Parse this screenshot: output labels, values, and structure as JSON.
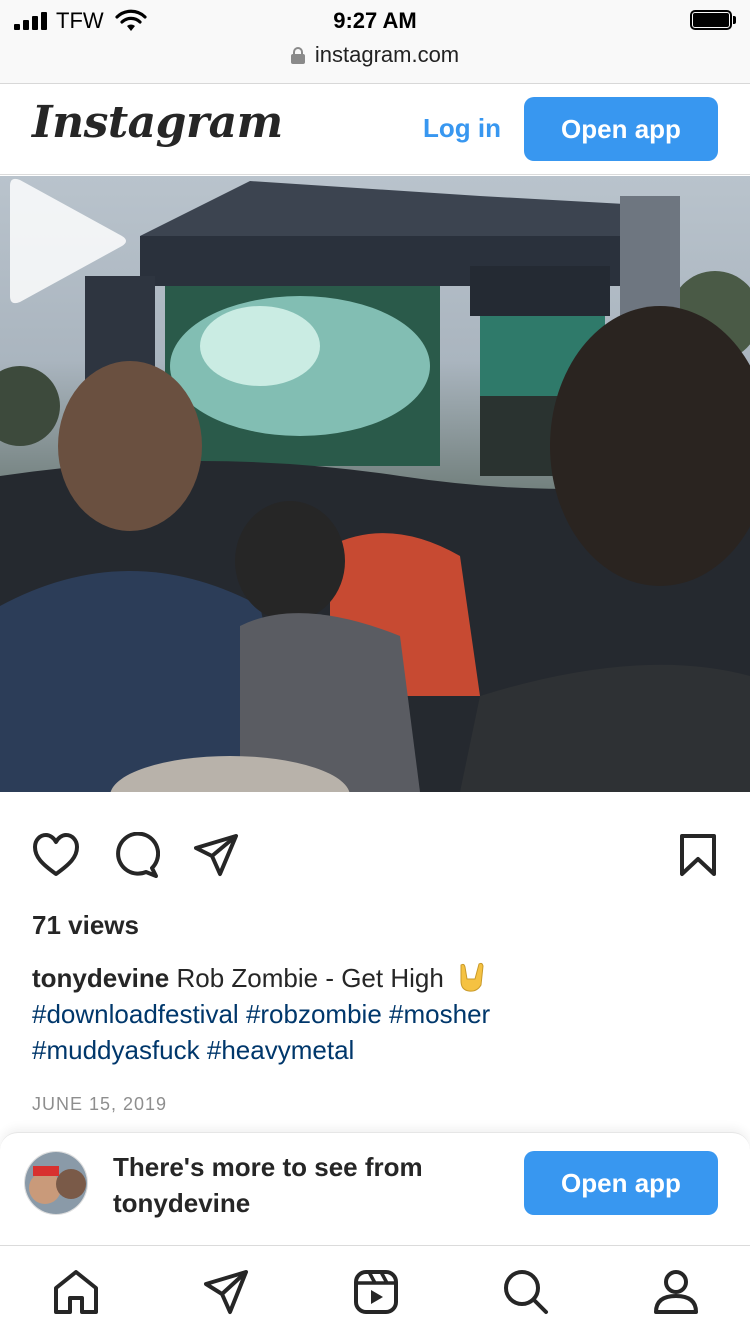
{
  "status_bar": {
    "carrier": "TFW",
    "time": "9:27 AM",
    "icons": [
      "signal-icon",
      "wifi-icon",
      "battery-icon"
    ]
  },
  "url_bar": {
    "domain": "instagram.com",
    "icon": "lock-icon"
  },
  "header": {
    "logo": "Instagram",
    "login_label": "Log in",
    "open_app_label": "Open app"
  },
  "video": {
    "description_icon": "play-icon"
  },
  "actions": {
    "icons": [
      "heart-icon",
      "comment-icon",
      "share-icon",
      "bookmark-icon"
    ]
  },
  "post": {
    "views": "71 views",
    "username": "tonydevine",
    "caption_text": "Rob Zombie - Get High",
    "hashtags_line1": [
      "#downloadfestival",
      "#robzombie",
      "#mosher"
    ],
    "hashtags_line2": [
      "#muddyasfuck",
      "#heavymetal"
    ],
    "date": "JUNE 15, 2019"
  },
  "banner": {
    "text_prefix": "There's more to see from",
    "username": "tonydevine",
    "button_label": "Open app"
  },
  "bottom_nav": {
    "items": [
      "home-icon",
      "direct-icon",
      "reels-icon",
      "search-icon",
      "profile-icon"
    ]
  },
  "colors": {
    "accent": "#3897f0",
    "hashtag": "#00376b",
    "text": "#262626",
    "muted": "#8e8e8e"
  }
}
